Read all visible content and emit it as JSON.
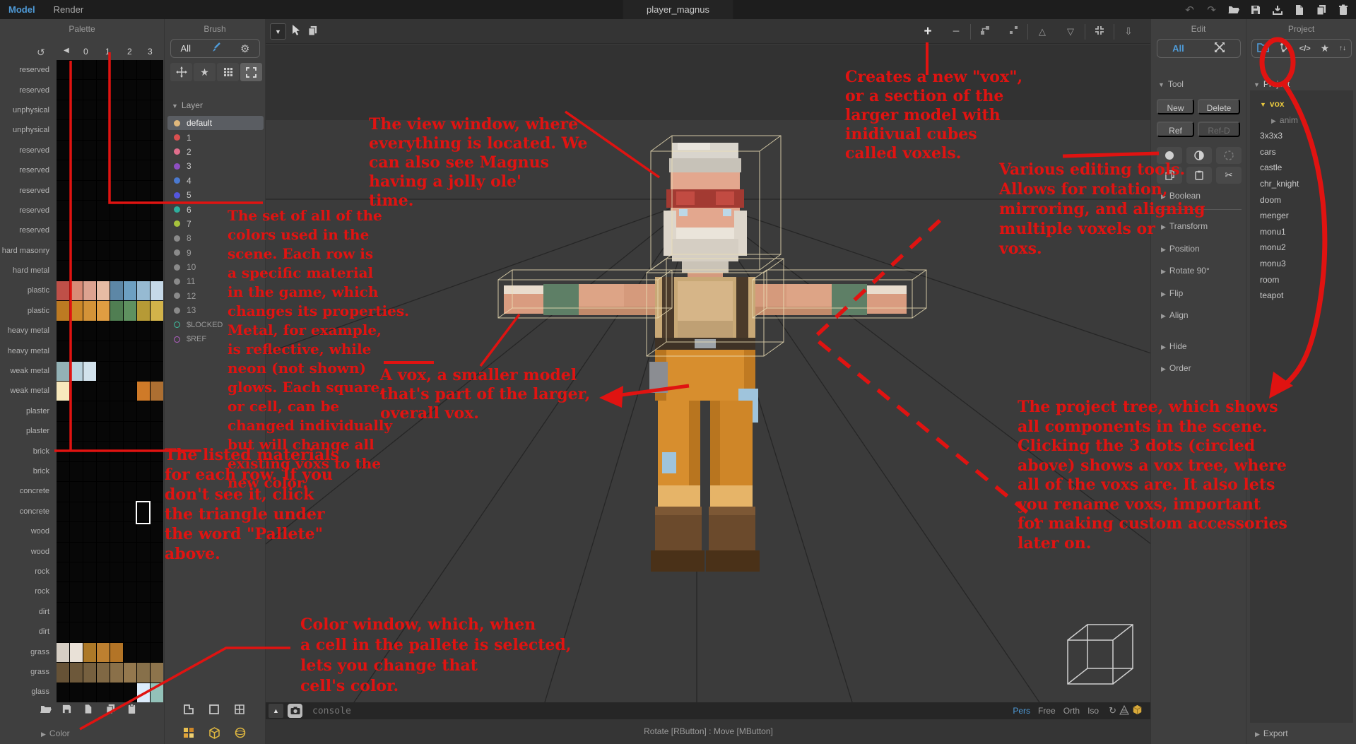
{
  "colors": {
    "annotation_red": "#e01311",
    "accent_blue": "#4f9bd8",
    "highlight_yellow": "#e7c73e",
    "panel_bg": "#3f3f3f",
    "viewport_bg": "#3b3b3b"
  },
  "app": {
    "tabs": [
      "Model",
      "Render"
    ],
    "active_tab": "Model",
    "title": "player_magnus",
    "topbar_icons": [
      "undo-icon",
      "redo-icon",
      "open-folder-icon",
      "save-icon",
      "import-icon",
      "new-file-icon",
      "copy-icon",
      "trash-icon"
    ]
  },
  "palette": {
    "header": "Palette",
    "header_icons": [
      "refresh-icon",
      "collapse-left-icon"
    ],
    "columns": [
      "0",
      "1",
      "2",
      "3"
    ],
    "rows": [
      {
        "label": "reserved"
      },
      {
        "label": "reserved"
      },
      {
        "label": "unphysical"
      },
      {
        "label": "unphysical"
      },
      {
        "label": "reserved"
      },
      {
        "label": "reserved"
      },
      {
        "label": "reserved"
      },
      {
        "label": "reserved"
      },
      {
        "label": "reserved"
      },
      {
        "label": "hard masonry"
      },
      {
        "label": "hard metal"
      },
      {
        "label": "plastic",
        "cells": {
          "0": "#bf5048",
          "1": "#d98b76",
          "2": "#dda390",
          "3": "#e7bca4",
          "4": "#5d87a6",
          "5": "#6da0c2",
          "6": "#96bad2",
          "7": "#c6d9e8"
        }
      },
      {
        "label": "plastic",
        "cells": {
          "0": "#bd7a22",
          "1": "#cd8828",
          "2": "#d49338",
          "3": "#e09d42",
          "4": "#507e52",
          "5": "#5f9160",
          "6": "#b69a36",
          "7": "#d2b34a"
        }
      },
      {
        "label": "heavy metal"
      },
      {
        "label": "heavy metal"
      },
      {
        "label": "weak metal",
        "cells": {
          "0": "#93b2b6",
          "1": "#bad2de",
          "2": "#d2e2ec"
        }
      },
      {
        "label": "weak metal",
        "cells": {
          "0": "#f7e9bd",
          "6": "#cf7a28",
          "7": "#ad6f32"
        }
      },
      {
        "label": "plaster"
      },
      {
        "label": "plaster"
      },
      {
        "label": "brick"
      },
      {
        "label": "brick"
      },
      {
        "label": "concrete"
      },
      {
        "label": "concrete"
      },
      {
        "label": "wood"
      },
      {
        "label": "wood"
      },
      {
        "label": "rock"
      },
      {
        "label": "rock"
      },
      {
        "label": "dirt"
      },
      {
        "label": "dirt"
      },
      {
        "label": "grass",
        "cells": {
          "0": "#d6cec4",
          "1": "#e9e1d7",
          "2": "#ad7928",
          "3": "#bd8030",
          "4": "#b37426"
        }
      },
      {
        "label": "grass",
        "cells": {
          "0": "#665236",
          "1": "#6d583a",
          "2": "#76603f",
          "3": "#806844",
          "4": "#8a7049",
          "5": "#94784e",
          "6": "#87704a",
          "7": "#8d744c"
        }
      },
      {
        "label": "glass",
        "cells": {
          "6": "#dcecfb",
          "7": "#93c2b9"
        }
      }
    ],
    "selected_cell": {
      "row": 22,
      "col": 6
    },
    "footer_icons": [
      "open-folder-icon",
      "save-icon",
      "new-file-icon",
      "copy-icon",
      "clipboard-icon"
    ],
    "color_section": "Color"
  },
  "brush": {
    "header": "Brush",
    "mode_label": "All",
    "pill_icons": [
      "brush-icon",
      "gear-icon"
    ],
    "tool_icons": [
      "move-icon",
      "star-icon",
      "grid-dots-icon",
      "marquee-icon"
    ],
    "active_tool": "marquee-icon",
    "layer_header": "Layer",
    "layers": [
      {
        "name": "default",
        "color": "#e0b87c",
        "selected": true
      },
      {
        "name": "1",
        "color": "#d94f4f"
      },
      {
        "name": "2",
        "color": "#e06e8c"
      },
      {
        "name": "3",
        "color": "#8e4fc2"
      },
      {
        "name": "4",
        "color": "#4a79cf"
      },
      {
        "name": "5",
        "color": "#5456de"
      },
      {
        "name": "6",
        "color": "#2eae9d"
      },
      {
        "name": "7",
        "color": "#a6c23c"
      },
      {
        "name": "8",
        "color": "#8a8a8a",
        "dim": true
      },
      {
        "name": "9",
        "color": "#8a8a8a",
        "dim": true
      },
      {
        "name": "10",
        "color": "#8a8a8a",
        "dim": true
      },
      {
        "name": "11",
        "color": "#8a8a8a",
        "dim": true
      },
      {
        "name": "12",
        "color": "#8a8a8a",
        "dim": true
      },
      {
        "name": "13",
        "color": "#8a8a8a",
        "dim": true
      },
      {
        "name": "$LOCKED",
        "color": "#3fbf9f",
        "hollow": true,
        "dim": true
      },
      {
        "name": "$REF",
        "color": "#b45fc5",
        "hollow": true,
        "dim": true
      }
    ],
    "footer_icons_row1": [
      "corner-icon",
      "square-icon",
      "grid-icon"
    ],
    "footer_icons_row2": [
      "swatches-icon",
      "cube-icon",
      "sphere-icon"
    ]
  },
  "viewport": {
    "left_icons": [
      "dropdown-icon",
      "cursor-icon",
      "copy-icon"
    ],
    "right_icons": [
      "plus-icon",
      "minus-icon",
      "attach-icon",
      "detach-icon",
      "triangle-up-icon",
      "triangle-down-icon",
      "center-icon",
      "download-icon"
    ],
    "console_placeholder": "console",
    "status_text": "Rotate [RButton] : Move [MButton]",
    "view_modes": [
      "Pers",
      "Free",
      "Orth",
      "Iso"
    ],
    "active_view_mode": "Pers",
    "corner_icons": [
      "rotate-icon",
      "axis-grid-icon",
      "cube-icon"
    ]
  },
  "edit": {
    "header": "Edit",
    "filter_label": "All",
    "filter_icons": [
      "expand-arrows-icon"
    ],
    "tool_section": "Tool",
    "buttons": [
      "New",
      "Delete",
      "Ref",
      "Ref-D"
    ],
    "disabled_button": "Ref-D",
    "shape_icons": [
      "circle-filled-icon",
      "circle-half-icon",
      "circle-dashed-icon"
    ],
    "clipboard_icons": [
      "copy-icon",
      "paste-icon",
      "scissors-icon"
    ],
    "sections": [
      "Boolean",
      "Transform",
      "Position",
      "Rotate 90°",
      "Flip",
      "Align",
      "Hide",
      "Order"
    ]
  },
  "project": {
    "header": "Project",
    "pill_icons": [
      "folder-icon",
      "tree-icon",
      "code-icon",
      "star-icon",
      "sort-icon"
    ],
    "tree_header": "Project",
    "items": [
      {
        "name": "vox",
        "arrow": "▼",
        "selected": true
      },
      {
        "name": "anim",
        "arrow": "▶",
        "child": true
      },
      {
        "name": "3x3x3"
      },
      {
        "name": "cars"
      },
      {
        "name": "castle"
      },
      {
        "name": "chr_knight"
      },
      {
        "name": "doom"
      },
      {
        "name": "menger"
      },
      {
        "name": "monu1"
      },
      {
        "name": "monu2"
      },
      {
        "name": "monu3"
      },
      {
        "name": "room"
      },
      {
        "name": "teapot"
      }
    ],
    "export_label": "Export"
  },
  "annotations": {
    "view_window": "The view window, where\neverything is located. We\ncan also see Magnus\nhaving a jolly ole'\ntime.",
    "create_vox": "Creates a new \"vox\",\nor a section of the\nlarger model with\ninidivual cubes\ncalled voxels.",
    "editing_tools": "Various editing tools.\nAllows for rotation,\nmirroring, and aligning\nmultiple voxels or\nvoxs.",
    "palette_colors": "The set of all of the\ncolors used in the\nscene. Each row is\na specific material\nin the game, which\nchanges its properties.\nMetal, for example,\nis reflective, while\nneon (not shown)\nglows. Each square,\nor cell, can be\nchanged individually\nbut will change all\nexisting voxs to the\nnew color.",
    "vox_part": "A vox, a smaller model\nthat's part of the larger,\noverall vox.",
    "materials": "The listed materials\nfor each row. If you\ndon't see it, click\nthe triangle under\nthe word \"Pallete\"\nabove.",
    "color_window": "Color window, which, when\na cell in the pallete is selected,\nlets you change that\ncell's color.",
    "project_tree": "The project tree, which shows\nall components in the scene.\nClicking the 3 dots (circled\nabove) shows a vox tree, where\nall of the voxs are. It also lets\nyou rename voxs, important\nfor making custom accessories\nlater on."
  }
}
